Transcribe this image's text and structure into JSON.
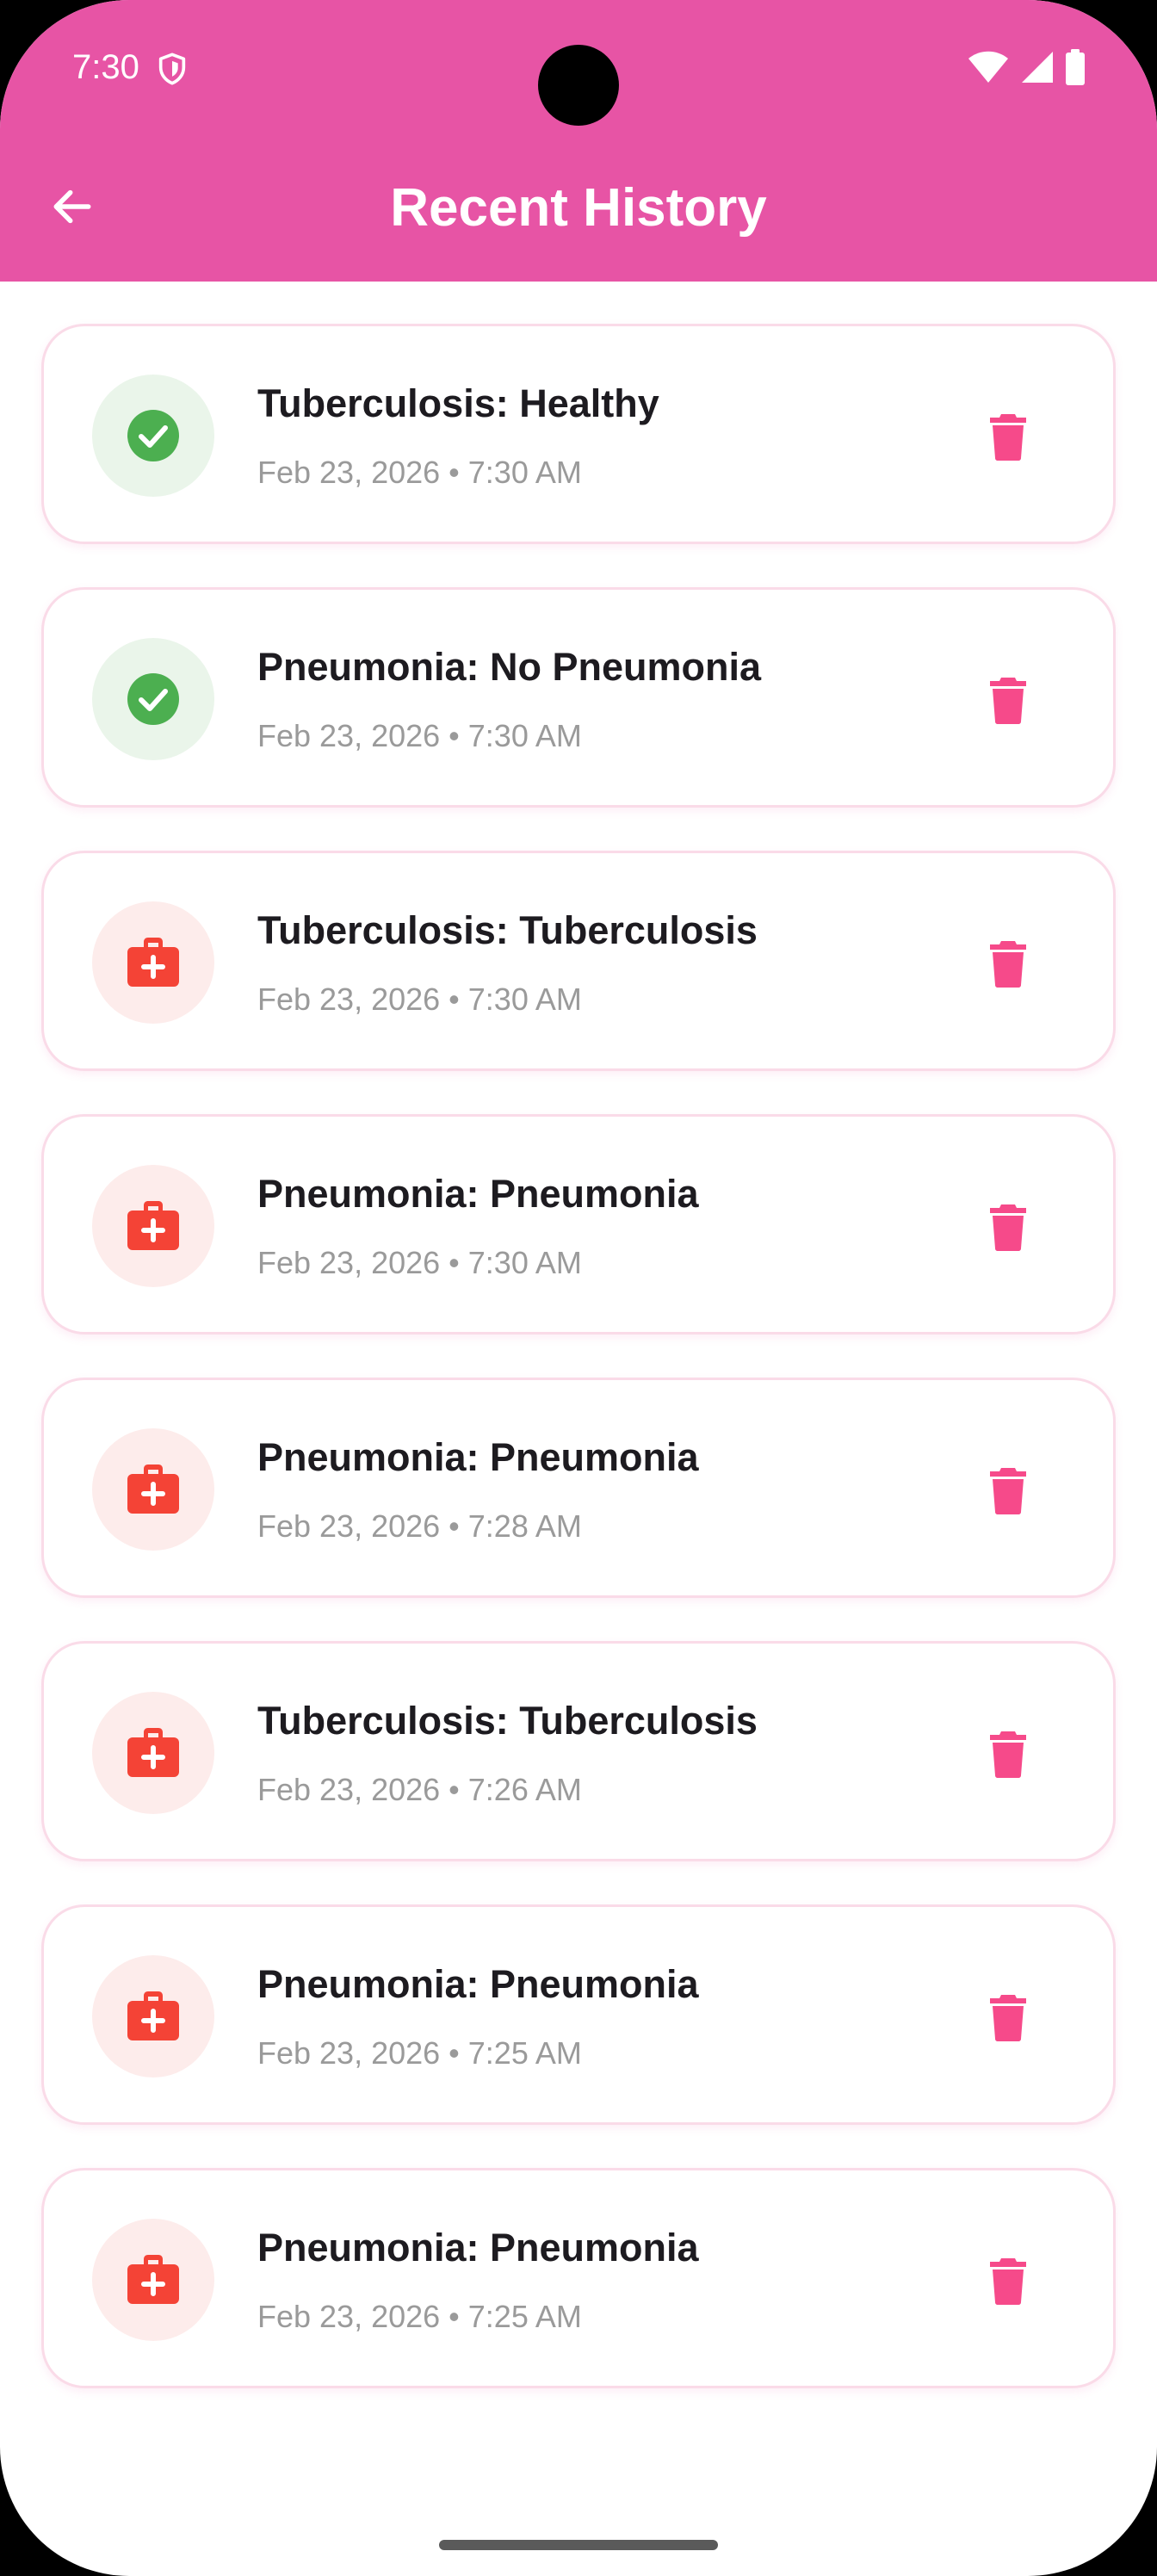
{
  "status_bar": {
    "time": "7:30",
    "icons": [
      "shield-icon",
      "wifi-icon",
      "cell-signal-icon",
      "battery-icon"
    ]
  },
  "app_bar": {
    "title": "Recent History",
    "back_icon": "arrow-left-icon",
    "color": "#e754a5"
  },
  "colors": {
    "accent": "#e754a5",
    "delete": "#f64a8a",
    "healthy": "#4caf50",
    "healthy_bg": "#eaf5ea",
    "disease": "#f44336",
    "disease_bg": "#fdeceb"
  },
  "history": [
    {
      "title": "Tuberculosis: Healthy",
      "date": "Feb 23, 2026 • 7:30 AM",
      "status": "healthy",
      "status_icon": "check-circle-icon",
      "action_icon": "trash-icon"
    },
    {
      "title": "Pneumonia: No Pneumonia",
      "date": "Feb 23, 2026 • 7:30 AM",
      "status": "healthy",
      "status_icon": "check-circle-icon",
      "action_icon": "trash-icon"
    },
    {
      "title": "Tuberculosis: Tuberculosis",
      "date": "Feb 23, 2026 • 7:30 AM",
      "status": "disease",
      "status_icon": "medical-kit-icon",
      "action_icon": "trash-icon"
    },
    {
      "title": "Pneumonia: Pneumonia",
      "date": "Feb 23, 2026 • 7:30 AM",
      "status": "disease",
      "status_icon": "medical-kit-icon",
      "action_icon": "trash-icon"
    },
    {
      "title": "Pneumonia: Pneumonia",
      "date": "Feb 23, 2026 • 7:28 AM",
      "status": "disease",
      "status_icon": "medical-kit-icon",
      "action_icon": "trash-icon"
    },
    {
      "title": "Tuberculosis: Tuberculosis",
      "date": "Feb 23, 2026 • 7:26 AM",
      "status": "disease",
      "status_icon": "medical-kit-icon",
      "action_icon": "trash-icon"
    },
    {
      "title": "Pneumonia: Pneumonia",
      "date": "Feb 23, 2026 • 7:25 AM",
      "status": "disease",
      "status_icon": "medical-kit-icon",
      "action_icon": "trash-icon"
    },
    {
      "title": "Pneumonia: Pneumonia",
      "date": "Feb 23, 2026 • 7:25 AM",
      "status": "disease",
      "status_icon": "medical-kit-icon",
      "action_icon": "trash-icon"
    }
  ]
}
